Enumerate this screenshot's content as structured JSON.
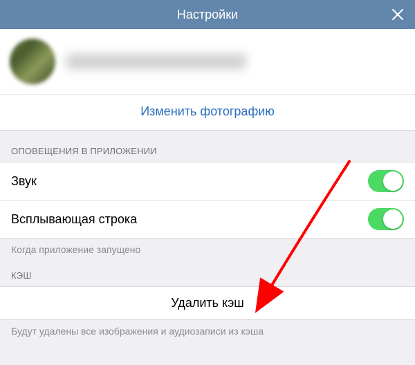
{
  "header": {
    "title": "Настройки"
  },
  "profile": {
    "change_photo_label": "Изменить фотографию"
  },
  "notifications": {
    "header": "ОПОВЕЩЕНИЯ В ПРИЛОЖЕНИИ",
    "sound_label": "Звук",
    "sound_on": true,
    "popup_label": "Всплывающая строка",
    "popup_on": true,
    "footer": "Когда приложение запущено"
  },
  "cache": {
    "header": "КЭШ",
    "clear_label": "Удалить кэш",
    "footer": "Будут удалены все изображения и аудиозаписи из кэша"
  }
}
